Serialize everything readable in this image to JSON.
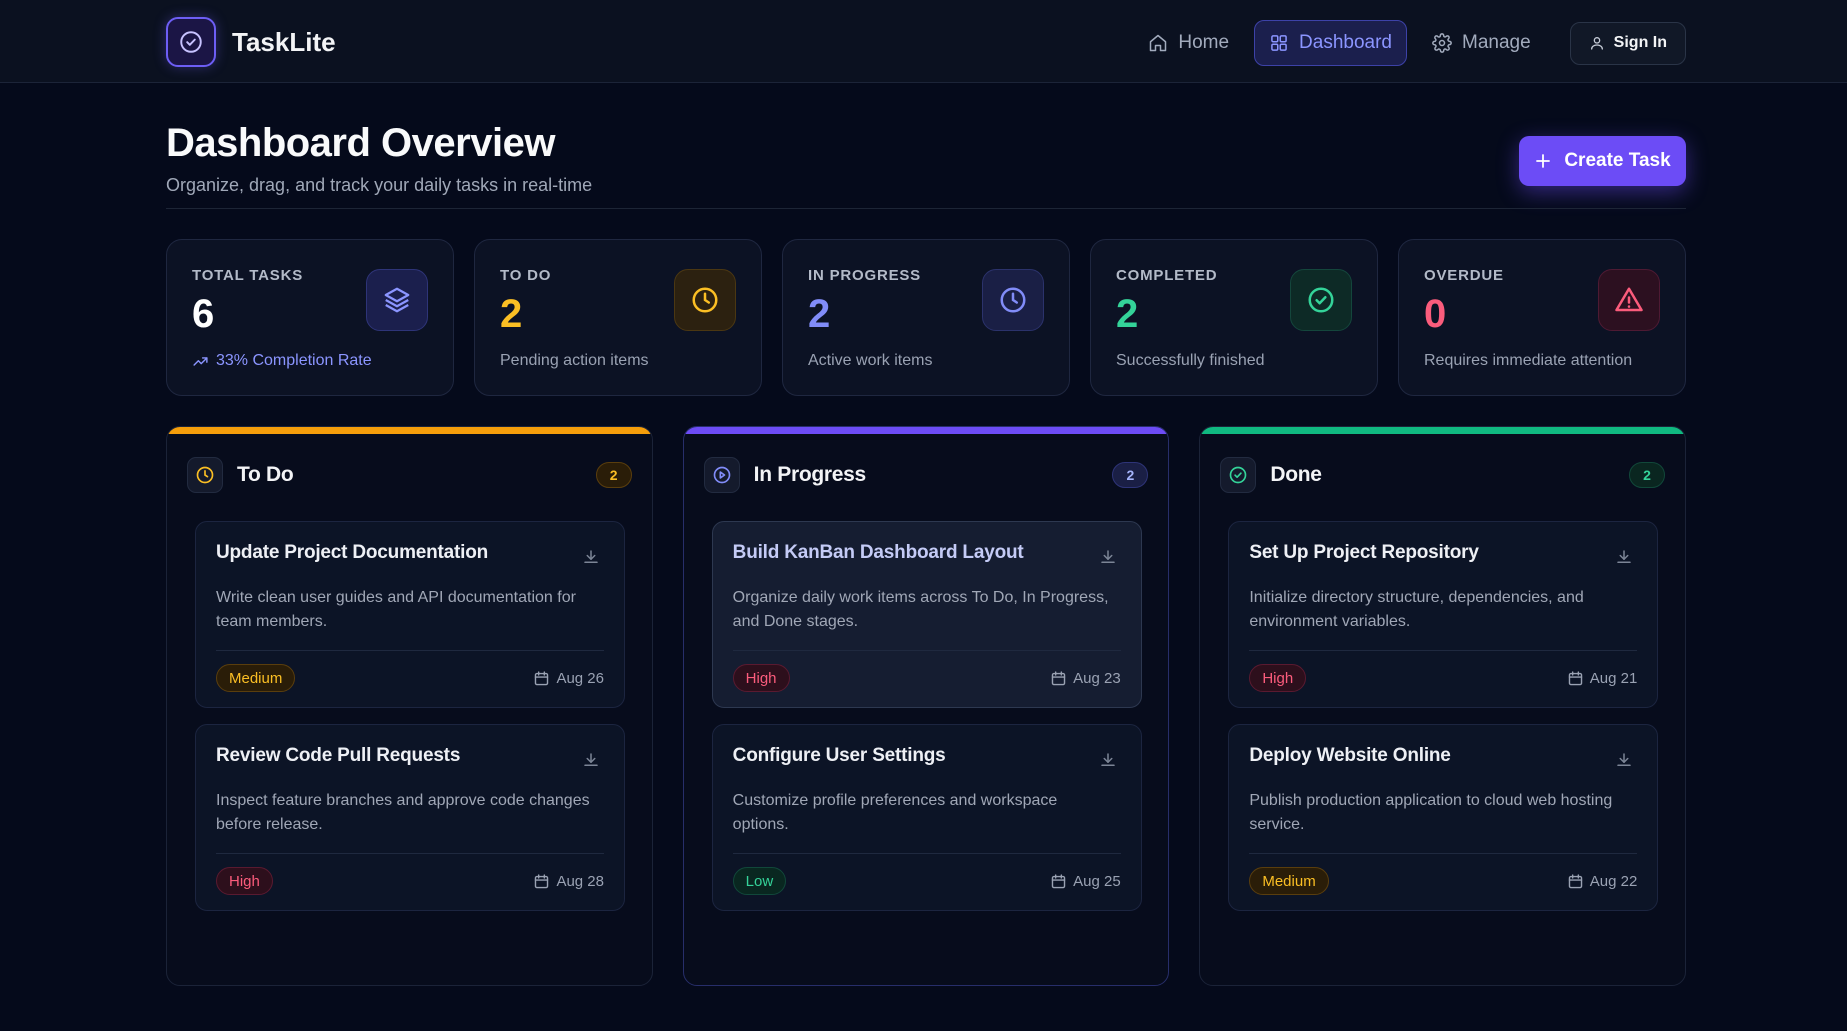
{
  "app": {
    "name": "TaskLite"
  },
  "nav": {
    "items": [
      {
        "label": "Home",
        "icon": "home-icon",
        "active": false
      },
      {
        "label": "Dashboard",
        "icon": "grid-icon",
        "active": true
      },
      {
        "label": "Manage",
        "icon": "gear-icon",
        "active": false
      }
    ],
    "signin_label": "Sign In"
  },
  "header": {
    "title": "Dashboard Overview",
    "subtitle": "Organize, drag, and track your daily tasks in real-time",
    "create_label": "Create Task"
  },
  "stats": [
    {
      "label": "TOTAL TASKS",
      "value": "6",
      "desc": "33% Completion Rate",
      "icon": "layers-icon",
      "color": "#ffffff",
      "desc_color": "#8b95ff",
      "icon_color": "#8b95ff",
      "icon_bg": "#1b1f4d",
      "icon_border": "#2e3478"
    },
    {
      "label": "TO DO",
      "value": "2",
      "desc": "Pending action items",
      "icon": "clock-icon",
      "color": "#fbbf24",
      "desc_color": "#9aa2b3",
      "icon_color": "#fbbf24",
      "icon_bg": "#2c2110",
      "icon_border": "#4b3712"
    },
    {
      "label": "IN PROGRESS",
      "value": "2",
      "desc": "Active work items",
      "icon": "clock-icon",
      "color": "#818cf8",
      "desc_color": "#9aa2b3",
      "icon_color": "#818cf8",
      "icon_bg": "#1a1f45",
      "icon_border": "#2b326b"
    },
    {
      "label": "COMPLETED",
      "value": "2",
      "desc": "Successfully finished",
      "icon": "check-circle-icon",
      "color": "#34d399",
      "desc_color": "#9aa2b3",
      "icon_color": "#34d399",
      "icon_bg": "#0d2a26",
      "icon_border": "#14463c"
    },
    {
      "label": "OVERDUE",
      "value": "0",
      "desc": "Requires immediate attention",
      "icon": "warning-icon",
      "color": "#fb5c7c",
      "desc_color": "#9aa2b3",
      "icon_color": "#fb5c7c",
      "icon_bg": "#2c1020",
      "icon_border": "#4e1a33"
    }
  ],
  "columns": [
    {
      "title": "To Do",
      "count": "2",
      "icon": "clock-icon",
      "bar_color": "#f59e0b",
      "icon_color": "#fbbf24",
      "count_bg": "#2a1d08",
      "count_border": "#5a3e0d",
      "count_color": "#fbbf24",
      "cards": [
        {
          "title": "Update Project Documentation",
          "desc": "Write clean user guides and API documentation for team members.",
          "priority": "Medium",
          "due": "Aug 26"
        },
        {
          "title": "Review Code Pull Requests",
          "desc": "Inspect feature branches and approve code changes before release.",
          "priority": "High",
          "due": "Aug 28"
        }
      ]
    },
    {
      "title": "In Progress",
      "count": "2",
      "icon": "play-circle-icon",
      "bar_color": "#6d4cf6",
      "icon_color": "#818cf8",
      "count_bg": "#1a1f45",
      "count_border": "#2e3478",
      "count_color": "#a5b4fc",
      "cards": [
        {
          "title": "Build KanBan Dashboard Layout",
          "desc": "Organize daily work items across To Do, In Progress, and Done stages.",
          "priority": "High",
          "due": "Aug 23"
        },
        {
          "title": "Configure User Settings",
          "desc": "Customize profile preferences and workspace options.",
          "priority": "Low",
          "due": "Aug 25"
        }
      ]
    },
    {
      "title": "Done",
      "count": "2",
      "icon": "check-circle-icon",
      "bar_color": "#10b981",
      "icon_color": "#34d399",
      "count_bg": "#0a2620",
      "count_border": "#11483a",
      "count_color": "#34d399",
      "cards": [
        {
          "title": "Set Up Project Repository",
          "desc": "Initialize directory structure, dependencies, and environment variables.",
          "priority": "High",
          "due": "Aug 21"
        },
        {
          "title": "Deploy Website Online",
          "desc": "Publish production application to cloud web hosting service.",
          "priority": "Medium",
          "due": "Aug 22"
        }
      ]
    }
  ]
}
